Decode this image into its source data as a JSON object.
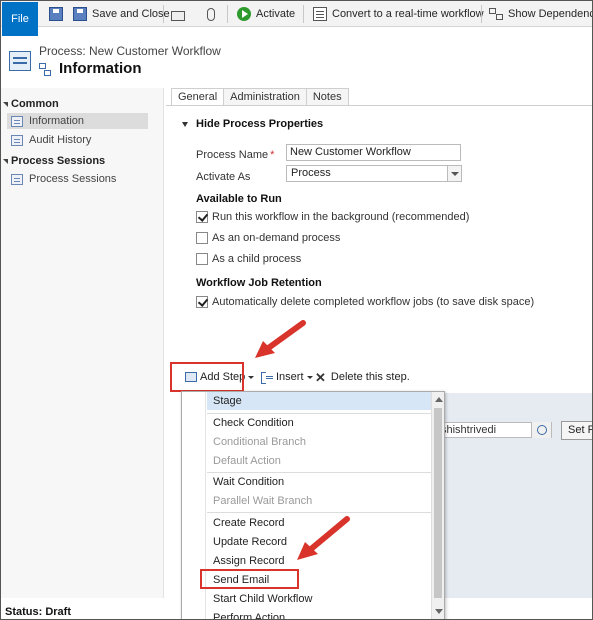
{
  "ribbon": {
    "file": "File",
    "save_and_close": "Save and Close",
    "activate": "Activate",
    "convert": "Convert to a real-time workflow",
    "show_dependencies": "Show Dependencies"
  },
  "header": {
    "entity_label": "Process: New Customer Workflow",
    "title": "Information"
  },
  "nav": {
    "common_label": "Common",
    "common_items": [
      "Information",
      "Audit History"
    ],
    "sessions_label": "Process Sessions",
    "sessions_items": [
      "Process Sessions"
    ]
  },
  "tabs": [
    "General",
    "Administration",
    "Notes"
  ],
  "section": {
    "title": "Hide Process Properties",
    "process_name_label": "Process Name",
    "process_name_value": "New Customer Workflow",
    "activate_as_label": "Activate As",
    "activate_as_value": "Process",
    "available_label": "Available to Run",
    "options": [
      {
        "label": "Run this workflow in the background (recommended)",
        "checked": true
      },
      {
        "label": "As an on-demand process",
        "checked": false
      },
      {
        "label": "As a child process",
        "checked": false
      }
    ],
    "retention_label": "Workflow Job Retention",
    "retention_option": {
      "label": "Automatically delete completed workflow jobs (to save disk space)",
      "checked": true
    }
  },
  "steps_toolbar": {
    "add_step": "Add Step",
    "insert": "Insert",
    "delete": "Delete this step."
  },
  "designer": {
    "owner_text": "shishtrivedi",
    "set_properties": "Set Pr"
  },
  "menu": {
    "items": [
      {
        "label": "Stage",
        "disabled": false,
        "hover": true
      },
      {
        "label": "Check Condition",
        "disabled": false
      },
      {
        "label": "Conditional Branch",
        "disabled": true
      },
      {
        "label": "Default Action",
        "disabled": true
      },
      {
        "label": "Wait Condition",
        "disabled": false
      },
      {
        "label": "Parallel Wait Branch",
        "disabled": true
      },
      {
        "label": "Create Record",
        "disabled": false
      },
      {
        "label": "Update Record",
        "disabled": false
      },
      {
        "label": "Assign Record",
        "disabled": false
      },
      {
        "label": "Send Email",
        "disabled": false
      },
      {
        "label": "Start Child Workflow",
        "disabled": false
      },
      {
        "label": "Perform Action",
        "disabled": false
      }
    ]
  },
  "status": "Status: Draft",
  "colors": {
    "accent": "#0072c6",
    "highlight": "#d9342b",
    "menu_hover": "#d7e6f6"
  }
}
